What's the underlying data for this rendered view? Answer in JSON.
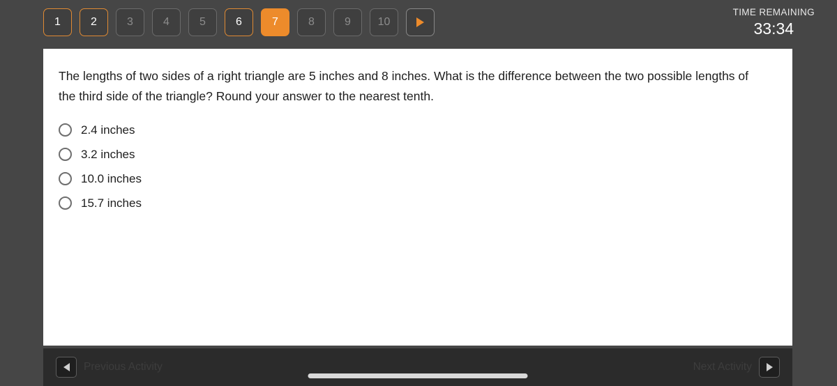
{
  "topbar": {
    "question_buttons": [
      {
        "label": "1",
        "state": "answered"
      },
      {
        "label": "2",
        "state": "answered"
      },
      {
        "label": "3",
        "state": "unvisited"
      },
      {
        "label": "4",
        "state": "unvisited"
      },
      {
        "label": "5",
        "state": "unvisited"
      },
      {
        "label": "6",
        "state": "answered"
      },
      {
        "label": "7",
        "state": "current"
      },
      {
        "label": "8",
        "state": "unvisited"
      },
      {
        "label": "9",
        "state": "unvisited"
      },
      {
        "label": "10",
        "state": "unvisited"
      }
    ],
    "next_question_icon": "play-triangle-right-icon",
    "timer": {
      "label": "TIME REMAINING",
      "value": "33:34"
    }
  },
  "question": {
    "text": "The lengths of two sides of a right triangle are 5 inches and 8 inches. What is the difference between the two possible lengths of the third side of the triangle? Round your answer to the nearest tenth.",
    "selected_option": null,
    "options": [
      {
        "label": "2.4 inches"
      },
      {
        "label": "3.2 inches"
      },
      {
        "label": "10.0 inches"
      },
      {
        "label": "15.7 inches"
      }
    ]
  },
  "footer": {
    "previous_label": "Previous Activity",
    "previous_icon": "play-triangle-left-icon",
    "next_label": "Next Activity",
    "next_icon": "play-triangle-right-icon",
    "home_indicator": "home-indicator-bar"
  },
  "colors": {
    "page_background": "#464646",
    "accent_orange": "#ED8B2B",
    "card_background": "#ffffff",
    "footer_background": "#2b2b2b",
    "disabled_text": "#8c8c8c"
  }
}
